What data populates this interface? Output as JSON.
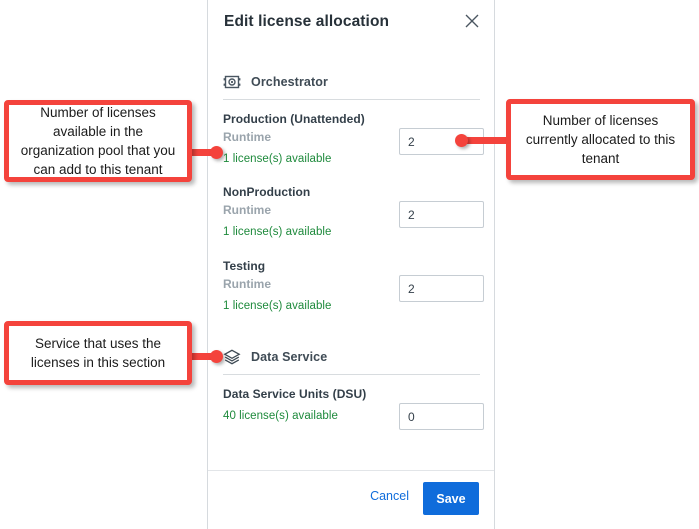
{
  "dialog": {
    "title": "Edit license allocation",
    "close_icon": "close-icon",
    "sections": [
      {
        "icon": "orchestrator-icon",
        "name": "Orchestrator",
        "rows": [
          {
            "title": "Production (Unattended)",
            "subtitle": "Runtime",
            "available": "1 license(s) available",
            "value": "2"
          },
          {
            "title": "NonProduction",
            "subtitle": "Runtime",
            "available": "1 license(s) available",
            "value": "2"
          },
          {
            "title": "Testing",
            "subtitle": "Runtime",
            "available": "1 license(s) available",
            "value": "2"
          }
        ]
      },
      {
        "icon": "data-service-icon",
        "name": "Data Service",
        "rows": [
          {
            "title": "Data Service Units (DSU)",
            "subtitle": "",
            "available": "40 license(s) available",
            "value": "0"
          }
        ]
      }
    ],
    "footer": {
      "cancel_label": "Cancel",
      "save_label": "Save"
    }
  },
  "annotations": {
    "available_pool": "Number of licenses available in the organization pool that you can add to this tenant",
    "allocated": "Number of licenses currently allocated to this tenant",
    "service_section": "Service that uses the licenses in this section"
  },
  "colors": {
    "accent": "#0f6cdb",
    "available_green": "#1e8a3c",
    "callout_red": "#f4433c",
    "title_text": "#273139",
    "muted_text": "#9aa4ac"
  }
}
